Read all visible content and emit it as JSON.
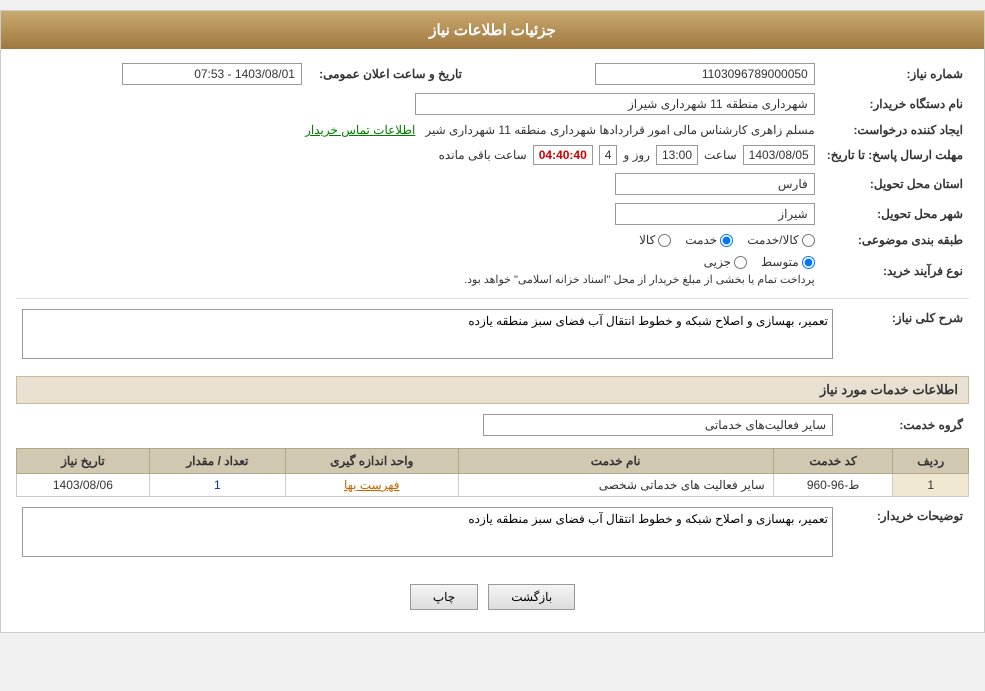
{
  "header": {
    "title": "جزئیات اطلاعات نیاز"
  },
  "fields": {
    "shomara_niaz_label": "شماره نیاز:",
    "shomara_niaz_value": "1103096789000050",
    "nam_dastgah_label": "نام دستگاه خریدار:",
    "nam_dastgah_value": "شهرداری منطقه 11 شهرداری شیراز",
    "ijad_konande_label": "ایجاد کننده درخواست:",
    "ijad_konande_value": "مسلم زاهری کارشناس مالی امور قراردادها شهرداری منطقه 11 شهرداری شیر",
    "ijad_konande_link": "اطلاعات تماس خریدار",
    "mohlat_label": "مهلت ارسال پاسخ: تا تاریخ:",
    "mohlat_date": "1403/08/05",
    "mohlat_saat_label": "ساعت",
    "mohlat_saat": "13:00",
    "mohlat_rooz_label": "روز و",
    "mohlat_rooz": "4",
    "mohlat_baqi_label": "ساعت باقی مانده",
    "mohlat_baqi": "04:40:40",
    "tarikh_aalan_label": "تاریخ و ساعت اعلان عمومی:",
    "tarikh_aalan_value": "1403/08/01 - 07:53",
    "ostan_label": "استان محل تحویل:",
    "ostan_value": "فارس",
    "shahr_label": "شهر محل تحویل:",
    "shahr_value": "شیراز",
    "tabe_label": "طبقه بندی موضوعی:",
    "tabe_options": [
      "کالا",
      "خدمت",
      "کالا/خدمت"
    ],
    "tabe_selected": "خدمت",
    "nooe_farayand_label": "نوع فرآیند خرید:",
    "nooe_options": [
      "جزیی",
      "متوسط"
    ],
    "nooe_selected": "متوسط",
    "nooe_note": "پرداخت تمام یا بخشی از مبلغ خریدار از محل \"اسناد خزانه اسلامی\" خواهد بود.",
    "sharh_label": "شرح کلی نیاز:",
    "sharh_value": "تعمیر، بهسازی و اصلاح شبکه و خطوط انتقال آب فضای سبز منطقه یازده",
    "khadamat_header": "اطلاعات خدمات مورد نیاز",
    "gorooh_label": "گروه خدمت:",
    "gorooh_value": "سایر فعالیت‌های خدماتی",
    "table": {
      "headers": [
        "ردیف",
        "کد خدمت",
        "نام خدمت",
        "واحد اندازه گیری",
        "تعداد / مقدار",
        "تاریخ نیاز"
      ],
      "rows": [
        {
          "radif": "1",
          "code": "ط-96-960",
          "name": "سایر فعالیت های خدماتی شخصی",
          "unit": "فهرست بها",
          "count": "1",
          "date": "1403/08/06"
        }
      ]
    },
    "tozihat_label": "توضیحات خریدار:",
    "tozihat_value": "تعمیر، بهسازی و اصلاح شبکه و خطوط انتقال آب فضای سبز منطقه یازده"
  },
  "buttons": {
    "print_label": "چاپ",
    "back_label": "بازگشت"
  }
}
